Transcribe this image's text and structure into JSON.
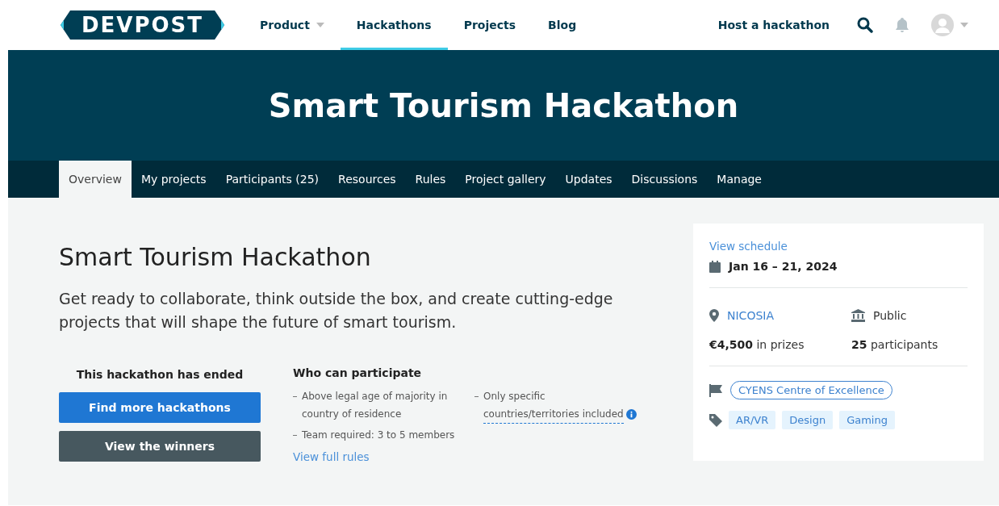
{
  "header": {
    "logo": "DEVPOST",
    "nav": [
      {
        "label": "Product",
        "selected": false,
        "dropdown": true
      },
      {
        "label": "Hackathons",
        "selected": true,
        "dropdown": false
      },
      {
        "label": "Projects",
        "selected": false,
        "dropdown": false
      },
      {
        "label": "Blog",
        "selected": false,
        "dropdown": false
      }
    ],
    "host_link": "Host a hackathon"
  },
  "banner": {
    "title": "Smart Tourism Hackathon"
  },
  "tabs": [
    {
      "label": "Overview",
      "selected": true
    },
    {
      "label": "My projects",
      "selected": false
    },
    {
      "label": "Participants (25)",
      "selected": false
    },
    {
      "label": "Resources",
      "selected": false
    },
    {
      "label": "Rules",
      "selected": false
    },
    {
      "label": "Project gallery",
      "selected": false
    },
    {
      "label": "Updates",
      "selected": false
    },
    {
      "label": "Discussions",
      "selected": false
    },
    {
      "label": "Manage",
      "selected": false
    }
  ],
  "main": {
    "title": "Smart Tourism Hackathon",
    "description": "Get ready to collaborate, think outside the box, and create cutting-edge projects that will shape the future of smart tourism.",
    "status": "This hackathon has ended",
    "buttons": [
      {
        "label": "Find more hackathons",
        "kind": "primary"
      },
      {
        "label": "View the winners",
        "kind": "secondary"
      }
    ],
    "eligibility": {
      "title": "Who can participate",
      "columns": [
        [
          {
            "text": "Above legal age of majority in country of residence"
          },
          {
            "text": "Team required: 3 to 5 members"
          }
        ],
        [
          {
            "text": "Only specific",
            "link": "countries/territories included"
          }
        ]
      ],
      "rules_link": "View full rules"
    }
  },
  "sidebar": {
    "schedule_link": "View schedule",
    "dates": "Jan 16 – 21, 2024",
    "location": "NICOSIA",
    "visibility": "Public",
    "prizes": {
      "amount": "€4,500",
      "label": "in prizes"
    },
    "participants": {
      "count": "25",
      "label": "participants"
    },
    "host": "CYENS Centre of Excellence",
    "tags": [
      "AR/VR",
      "Design",
      "Gaming"
    ]
  }
}
